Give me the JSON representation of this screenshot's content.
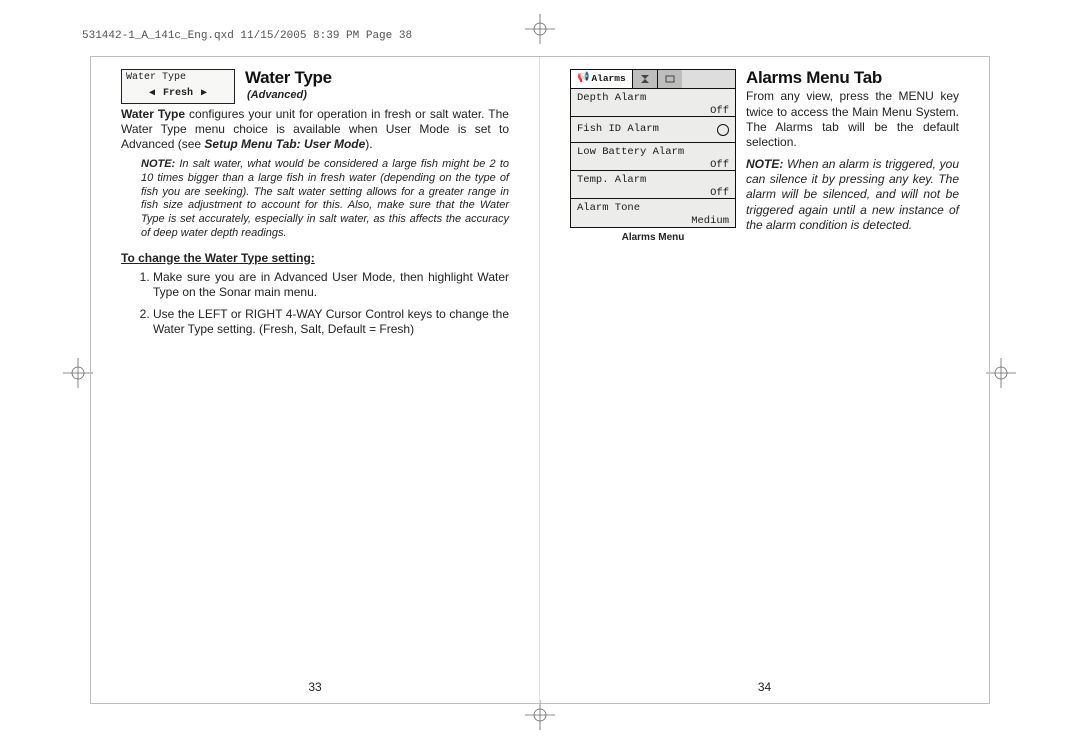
{
  "header": "531442-1_A_141c_Eng.qxd  11/15/2005  8:39 PM  Page 38",
  "left": {
    "widget": {
      "title": "Water Type",
      "value": "Fresh"
    },
    "title": "Water Type",
    "subtitle": "(Advanced)",
    "paragraph_lead_bold": "Water Type",
    "paragraph_rest": " configures your unit for operation in fresh or salt water. The Water Type menu choice is available when User Mode is set to Advanced (see ",
    "paragraph_ref": "Setup Menu Tab: User Mode",
    "paragraph_end": ").",
    "note_label": "NOTE:",
    "note_body": "  In salt water, what would be considered a large fish might be 2 to 10 times bigger than a large fish in fresh water (depending on the type of fish you are seeking).  The salt water setting allows for a greater range in fish size adjustment to account for this.  Also, make sure that the Water Type is set accurately, especially in salt water, as this affects the accuracy of deep water depth readings.",
    "subhead": "To change the Water Type setting:",
    "steps": [
      "Make sure you are in Advanced User Mode, then highlight Water Type on the Sonar main menu.",
      "Use the LEFT or RIGHT 4-WAY Cursor Control keys to change the Water Type setting. (Fresh, Salt, Default = Fresh)"
    ],
    "pagenum": "33"
  },
  "right": {
    "title": "Alarms Menu Tab",
    "widget": {
      "tab_label": "Alarms",
      "rows": [
        {
          "name": "Depth Alarm",
          "val": "Off"
        },
        {
          "name": "Fish ID Alarm",
          "val": ""
        },
        {
          "name": "Low Battery Alarm",
          "val": "Off"
        },
        {
          "name": "Temp. Alarm",
          "val": "Off"
        },
        {
          "name": "Alarm Tone",
          "val": "Medium"
        }
      ],
      "caption": "Alarms Menu"
    },
    "paragraph": "From any view, press the MENU key twice to access the Main Menu System. The Alarms tab will be the default selection.",
    "note_label": "NOTE:",
    "note_body": " When an alarm is triggered, you can silence it by pressing any key.  The alarm will be silenced, and will not be triggered again until a new instance of the alarm condition is detected.",
    "pagenum": "34"
  }
}
